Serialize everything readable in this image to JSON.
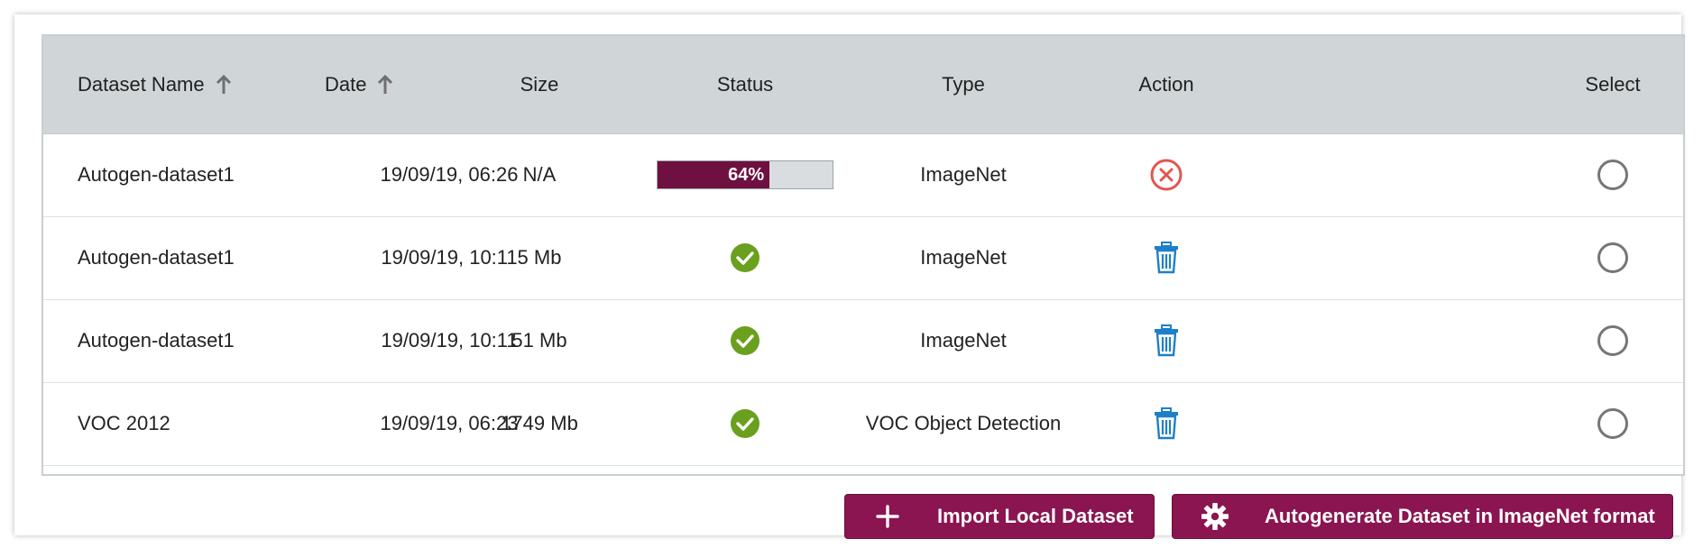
{
  "table": {
    "columns": [
      {
        "label": "Dataset Name",
        "sortable": true
      },
      {
        "label": "Date",
        "sortable": true
      },
      {
        "label": "Size",
        "sortable": false
      },
      {
        "label": "Status",
        "sortable": false
      },
      {
        "label": "Type",
        "sortable": false
      },
      {
        "label": "Action",
        "sortable": false
      },
      {
        "label": "Select",
        "sortable": false
      }
    ],
    "rows": [
      {
        "name": "Autogen-dataset1",
        "date": "19/09/19, 06:26",
        "size": "N/A",
        "status": "in-progress",
        "progress_label": "64%",
        "progress_value": 0.64,
        "type": "ImageNet",
        "action_icon": "cancel-icon"
      },
      {
        "name": "Autogen-dataset1",
        "date": "19/09/19, 10:11",
        "size": "5 Mb",
        "status": "complete",
        "type": "ImageNet",
        "action_icon": "trash-icon"
      },
      {
        "name": "Autogen-dataset1",
        "date": "19/09/19, 10:11",
        "size": "51 Mb",
        "status": "complete",
        "type": "ImageNet",
        "action_icon": "trash-icon"
      },
      {
        "name": "VOC 2012",
        "date": "19/09/19, 06:23",
        "size": "1749 Mb",
        "status": "complete",
        "type": "VOC Object Detection",
        "action_icon": "trash-icon"
      }
    ]
  },
  "buttons": {
    "import_label": "Import Local Dataset",
    "import_icon": "plus-icon",
    "autogen_label": "Autogenerate Dataset in ImageNet format",
    "autogen_icon": "gear-icon"
  },
  "colors": {
    "header_bg": "#d0d6d8",
    "progress_fill": "#6e1040",
    "button_bg": "#8a1550",
    "success": "#6aa01e",
    "danger": "#e0574f",
    "trash": "#1f7fc9"
  }
}
